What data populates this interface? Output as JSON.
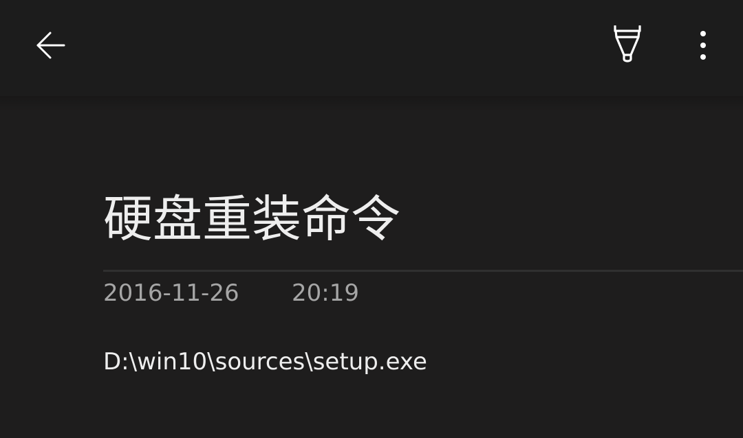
{
  "toolbar": {
    "back_icon": "arrow-left-icon",
    "pen_icon": "pen-icon",
    "more_icon": "more-vertical-icon"
  },
  "note": {
    "title": "硬盘重装命令",
    "date": "2016-11-26",
    "time": "20:19",
    "body": "D:\\win10\\sources\\setup.exe"
  },
  "colors": {
    "background": "#1e1d1d",
    "toolbar": "#1c1c1c",
    "text": "#eeeeee",
    "meta": "#a6a6a6",
    "divider": "#303030"
  }
}
